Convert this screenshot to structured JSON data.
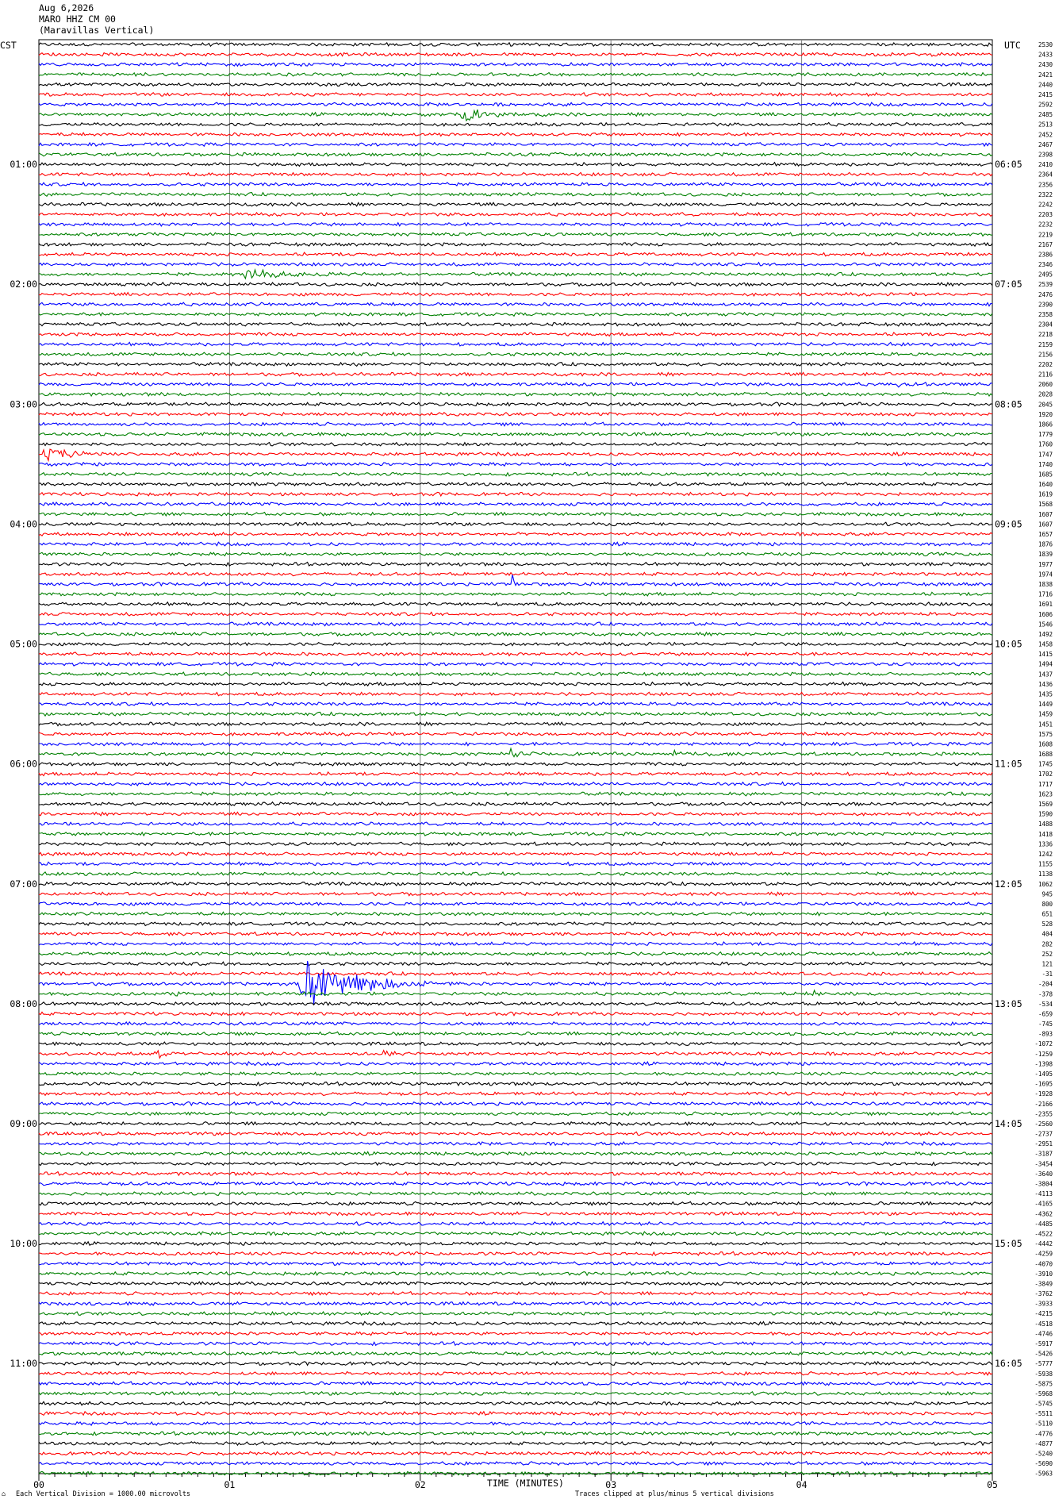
{
  "header": {
    "date": "Aug 6,2026",
    "station": "MARO HHZ CM 00",
    "site": "(Maravillas Vertical)"
  },
  "left_tz": "CST",
  "right_tz": "UTC",
  "footer": {
    "scale_icon": "scale-glyph",
    "scale": "Each Vertical Division = 1000.00 microvolts",
    "clip": "Traces clipped at plus/minus 5 vertical divisions"
  },
  "colors": {
    "cycle": [
      "#000000",
      "#ff0000",
      "#0000ff",
      "#008000"
    ],
    "grid": "#808080"
  },
  "chart_data": {
    "type": "line",
    "title": "",
    "xlabel": "TIME (MINUTES)",
    "x_ticks": [
      "00",
      "01",
      "02",
      "03",
      "04",
      "05"
    ],
    "x_range": [
      0,
      5
    ],
    "trace_count": 144,
    "left_time_labels": [
      "01:00",
      "02:00",
      "03:00",
      "04:00",
      "05:00",
      "06:00",
      "07:00",
      "08:00",
      "09:00",
      "10:00",
      "11:00"
    ],
    "left_label_rows": [
      12,
      24,
      36,
      48,
      60,
      72,
      84,
      96,
      108,
      120,
      132
    ],
    "right_time_labels": [
      "06:05",
      "07:05",
      "08:05",
      "09:05",
      "10:05",
      "11:05",
      "12:05",
      "13:05",
      "14:05",
      "15:05",
      "16:05"
    ],
    "right_label_rows": [
      12,
      24,
      36,
      48,
      60,
      72,
      84,
      96,
      108,
      120,
      132
    ],
    "row_offsets": [
      2530,
      2433,
      2430,
      2421,
      2440,
      2415,
      2592,
      2485,
      2513,
      2452,
      2467,
      2398,
      2410,
      2364,
      2356,
      2322,
      2242,
      2203,
      2232,
      2219,
      2167,
      2386,
      2346,
      2495,
      2539,
      2476,
      2390,
      2358,
      2304,
      2218,
      2159,
      2156,
      2202,
      2116,
      2060,
      2028,
      2045,
      1920,
      1866,
      1779,
      1760,
      1747,
      1740,
      1685,
      1640,
      1619,
      1568,
      1607,
      1607,
      1657,
      1876,
      1839,
      1977,
      1974,
      1838,
      1716,
      1691,
      1606,
      1546,
      1492,
      1458,
      1415,
      1494,
      1437,
      1436,
      1435,
      1449,
      1459,
      1451,
      1575,
      1608,
      1688,
      1745,
      1702,
      1717,
      1623,
      1569,
      1590,
      1488,
      1418,
      1336,
      1242,
      1155,
      1138,
      1062,
      945,
      800,
      651,
      528,
      404,
      282,
      252,
      121,
      -31,
      -204,
      -378,
      -534,
      -659,
      -745,
      -893,
      -1072,
      -1259,
      -1398,
      -1495,
      -1695,
      -1928,
      -2166,
      -2355,
      -2560,
      -2737,
      -2951,
      -3187,
      -3454,
      -3640,
      -3804,
      -4113,
      -4165,
      -4362,
      -4485,
      -4522,
      -4442,
      -4259,
      -4070,
      -3910,
      -3849,
      -3762,
      -3933,
      -4215,
      -4518,
      -4746,
      -5917,
      -5426,
      -5777,
      -5938,
      -5875,
      -5968,
      -5745,
      -5511,
      -5110,
      -4776,
      -4877,
      -5240,
      -5690,
      -5963
    ],
    "noise_amplitude_divisions": 0.3,
    "events": [
      {
        "row": 7,
        "start_min": 2.2,
        "end_min": 2.75,
        "amp": 2.0
      },
      {
        "row": 23,
        "start_min": 1.05,
        "end_min": 1.95,
        "amp": 1.2
      },
      {
        "row": 34,
        "start_min": 4.5,
        "end_min": 4.62,
        "amp": 1.0
      },
      {
        "row": 40,
        "start_min": 4.95,
        "end_min": 5.0,
        "amp": 2.5
      },
      {
        "row": 41,
        "start_min": 0.0,
        "end_min": 0.55,
        "amp": 1.8
      },
      {
        "row": 54,
        "start_min": 2.48,
        "end_min": 2.55,
        "amp": 2.5
      },
      {
        "row": 71,
        "start_min": 2.45,
        "end_min": 2.6,
        "amp": 2.0
      },
      {
        "row": 71,
        "start_min": 3.3,
        "end_min": 3.6,
        "amp": 1.2
      },
      {
        "row": 94,
        "start_min": 1.36,
        "end_min": 2.2,
        "amp": 6.5
      },
      {
        "row": 95,
        "start_min": 0.7,
        "end_min": 0.82,
        "amp": 1.5
      },
      {
        "row": 95,
        "start_min": 4.05,
        "end_min": 4.2,
        "amp": 1.2
      },
      {
        "row": 101,
        "start_min": 0.6,
        "end_min": 0.85,
        "amp": 1.2
      },
      {
        "row": 101,
        "start_min": 1.8,
        "end_min": 2.0,
        "amp": 1.0
      }
    ]
  }
}
